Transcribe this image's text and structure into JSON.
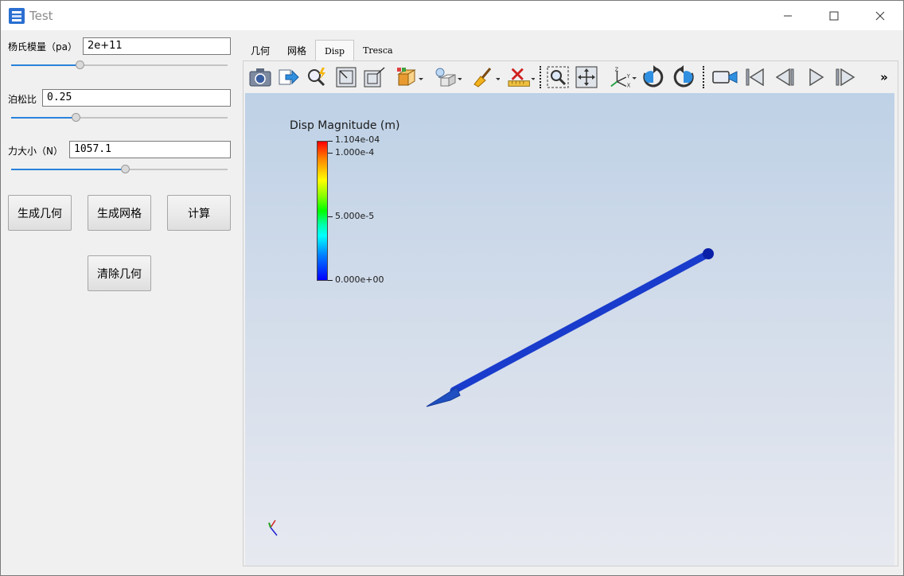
{
  "window": {
    "title": "Test",
    "icons": [
      "app-icon",
      "minimize-icon",
      "maximize-icon",
      "close-icon"
    ]
  },
  "params": {
    "youngs_modulus": {
      "label": "杨氏模量（pa）",
      "value": "2e+11",
      "slider_fraction": 0.32
    },
    "poisson_ratio": {
      "label": "泊松比",
      "value": "0.25",
      "slider_fraction": 0.3
    },
    "force": {
      "label": "力大小（N）",
      "value": "1057.1",
      "slider_fraction": 0.53
    }
  },
  "buttons": {
    "gen_geometry": "生成几何",
    "gen_mesh": "生成网格",
    "compute": "计算",
    "clear_geometry": "清除几何"
  },
  "tabs": [
    {
      "label": "几何",
      "active": false
    },
    {
      "label": "网格",
      "active": false
    },
    {
      "label": "Disp",
      "active": true
    },
    {
      "label": "Tresca",
      "active": false
    }
  ],
  "toolbar": {
    "icons": [
      "camera-icon",
      "export-arrow-icon",
      "magic-zoom-icon",
      "box-corner-icon",
      "box-maximize-icon",
      "box-3d-icon",
      "lightbulb-box-icon",
      "broom-icon",
      "ruler-x-icon",
      "zoom-box-icon",
      "fit-view-icon",
      "axes-xyz-icon",
      "rotate-cw-icon",
      "rotate-ccw-icon",
      "video-camera-icon",
      "skip-first-icon",
      "step-back-icon",
      "play-icon",
      "skip-last-icon"
    ],
    "overflow": "»"
  },
  "viewport": {
    "legend_title": "Disp Magnitude (m)",
    "legend_max": "1.104e-04",
    "legend_labels": [
      "1.000e-4",
      "5.000e-5",
      "0.000e+00"
    ],
    "legend_colors": [
      "#ff0000",
      "#ffff00",
      "#00ff00",
      "#00ffff",
      "#0000ff"
    ],
    "background_top": "#bed1e6",
    "background_bottom": "#e7e9f0",
    "model_color": "#1a3ccc",
    "orientation_axes": "axes-triad-icon"
  }
}
